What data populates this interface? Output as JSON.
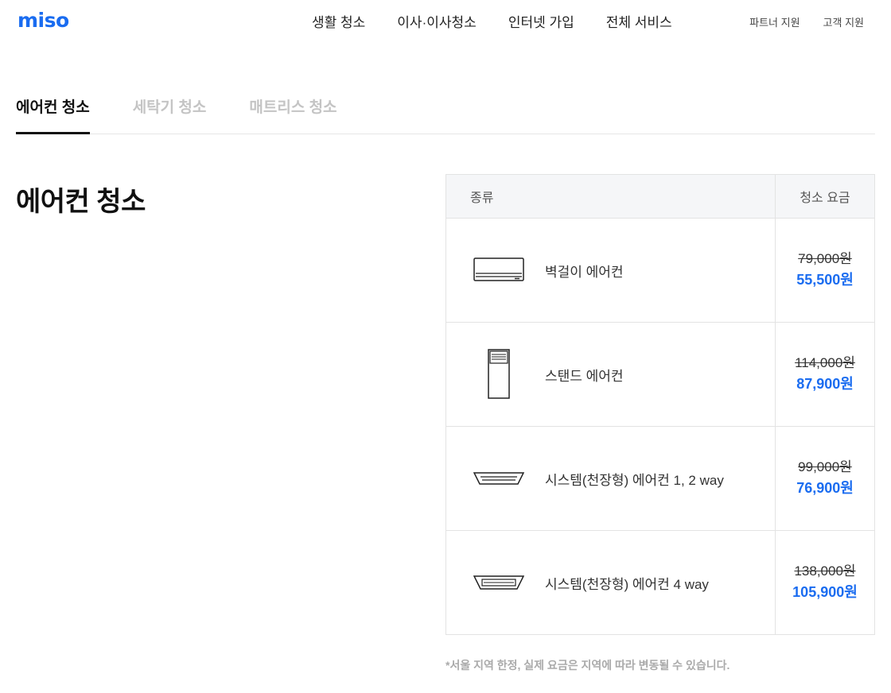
{
  "header": {
    "logo": "miso",
    "nav": [
      "생활 청소",
      "이사·이사청소",
      "인터넷 가입",
      "전체 서비스"
    ],
    "sub_nav": [
      "파트너 지원",
      "고객 지원"
    ]
  },
  "tabs": [
    {
      "label": "에어컨 청소",
      "active": true
    },
    {
      "label": "세탁기 청소",
      "active": false
    },
    {
      "label": "매트리스 청소",
      "active": false
    }
  ],
  "section_title": "에어컨 청소",
  "table": {
    "headers": {
      "type": "종류",
      "price": "청소 요금"
    },
    "rows": [
      {
        "icon": "wall-ac-icon",
        "name": "벽걸이 에어컨",
        "old_price": "79,000원",
        "new_price": "55,500원"
      },
      {
        "icon": "stand-ac-icon",
        "name": "스탠드 에어컨",
        "old_price": "114,000원",
        "new_price": "87,900원"
      },
      {
        "icon": "ceiling-ac-2way-icon",
        "name": "시스템(천장형) 에어컨 1, 2 way",
        "old_price": "99,000원",
        "new_price": "76,900원"
      },
      {
        "icon": "ceiling-ac-4way-icon",
        "name": "시스템(천장형) 에어컨 4 way",
        "old_price": "138,000원",
        "new_price": "105,900원"
      }
    ]
  },
  "footnote": "*서울 지역 한정, 실제 요금은 지역에 따라 변동될 수 있습니다.",
  "colors": {
    "accent": "#1a6cf0",
    "inactive_tab": "#c4c4c4",
    "header_bg": "#f5f6f8"
  }
}
